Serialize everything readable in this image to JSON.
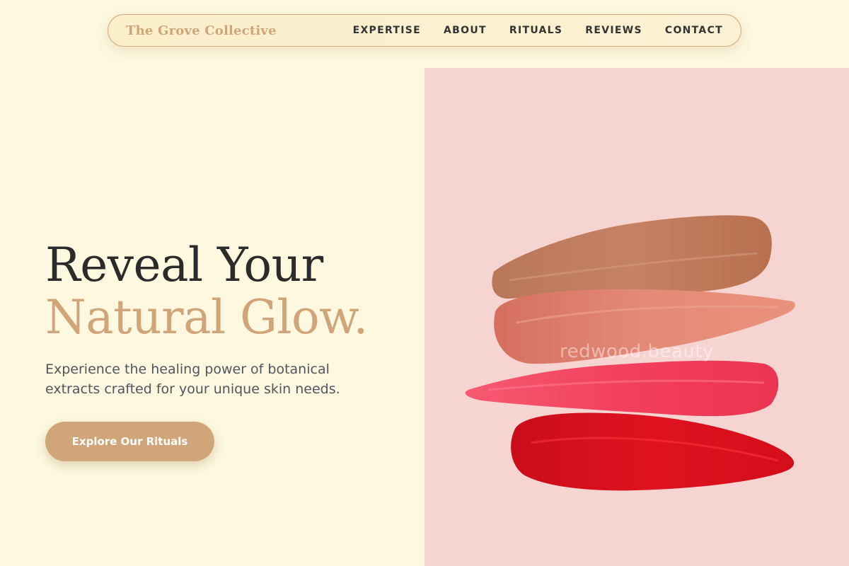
{
  "nav": {
    "brand": "The Grove Collective",
    "links": [
      "EXPERTISE",
      "ABOUT",
      "RITUALS",
      "REVIEWS",
      "CONTACT"
    ]
  },
  "hero": {
    "headline_line1": "Reveal Your",
    "headline_line2": "Natural Glow.",
    "subtitle": "Experience the healing power of botanical extracts crafted for your unique skin needs.",
    "cta_label": "Explore Our Rituals",
    "image": {
      "description_icon": "lipstick-swatches-image",
      "watermark": "redwood.beauty"
    }
  },
  "colors": {
    "background": "#fdf8df",
    "accent": "#d1a57a",
    "text_dark": "#2b2b2b",
    "image_bg": "#f6d4d1",
    "swatch_1": "#c0795c",
    "swatch_2": "#de7d6e",
    "swatch_3": "#f2415f",
    "swatch_4": "#d9101e"
  }
}
